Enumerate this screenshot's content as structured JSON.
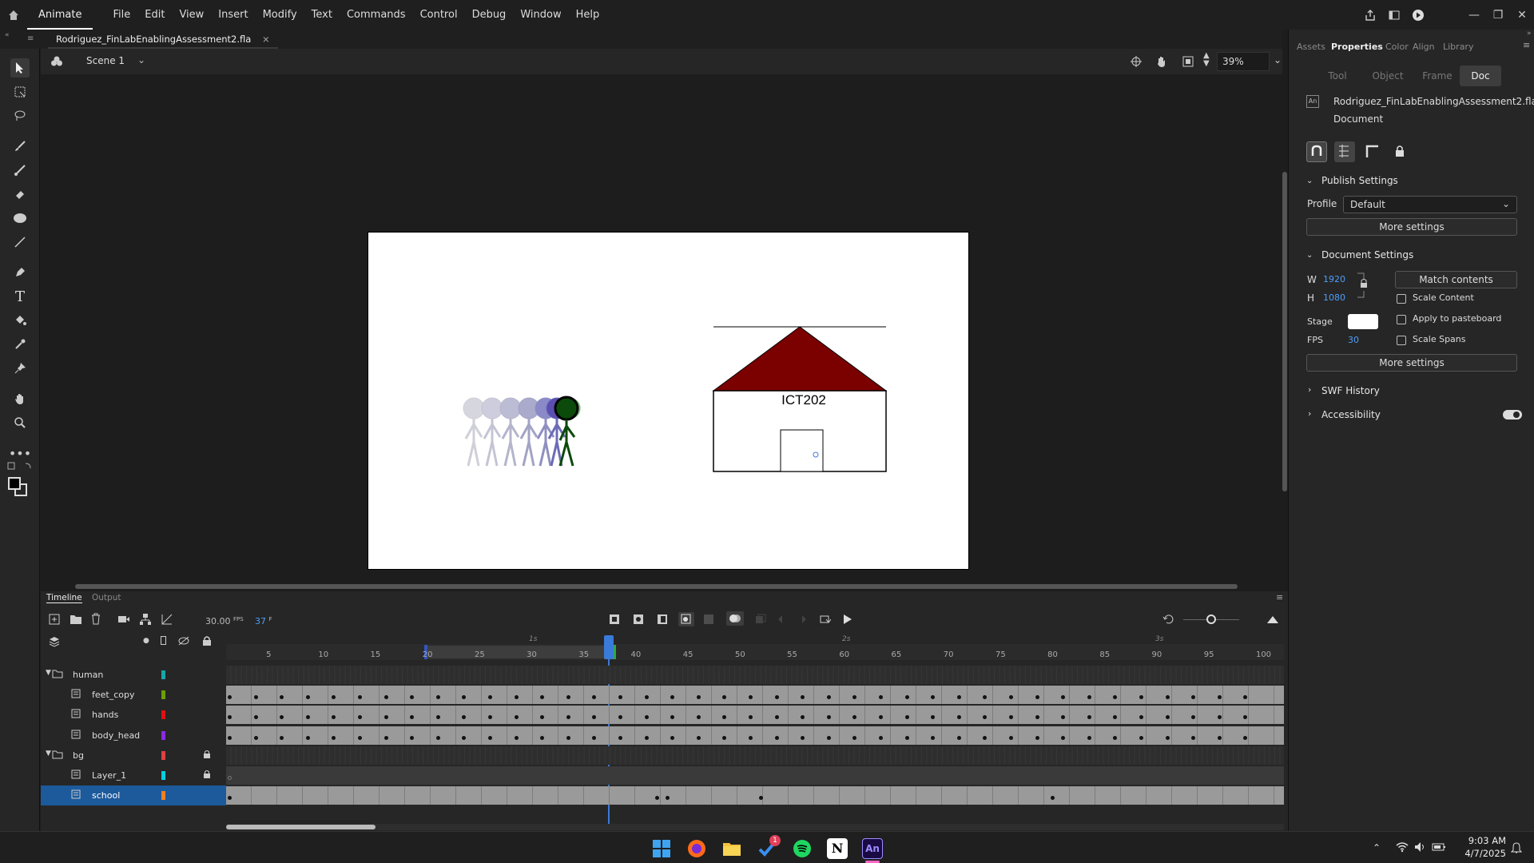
{
  "menubar": {
    "app_name": "Animate",
    "items": [
      "File",
      "Edit",
      "View",
      "Insert",
      "Modify",
      "Text",
      "Commands",
      "Control",
      "Debug",
      "Window",
      "Help"
    ]
  },
  "document_tab": {
    "filename": "Rodriguez_FinLabEnablingAssessment2.fla",
    "close": "×"
  },
  "scene": {
    "name": "Scene 1",
    "zoom": "39%"
  },
  "stage": {
    "house_label": "ICT202",
    "colors": {
      "roof": "#7b0000",
      "stick_figure": "#0b4a0b"
    }
  },
  "right_panel": {
    "tabs": [
      "Assets",
      "Properties",
      "Color",
      "Align",
      "Library"
    ],
    "active_tab": "Properties",
    "subtabs": [
      "Tool",
      "Object",
      "Frame",
      "Doc"
    ],
    "active_subtab": "Doc",
    "doc_filename": "Rodriguez_FinLabEnablingAssessment2.fla",
    "doc_type": "Document",
    "publish": {
      "heading": "Publish Settings",
      "profile_label": "Profile",
      "profile_value": "Default",
      "more_settings": "More settings"
    },
    "document_settings": {
      "heading": "Document Settings",
      "w_label": "W",
      "w_value": "1920",
      "h_label": "H",
      "h_value": "1080",
      "match_contents": "Match contents",
      "scale_content": "Scale Content",
      "stage_label": "Stage",
      "apply_pasteboard": "Apply to pasteboard",
      "fps_label": "FPS",
      "fps_value": "30",
      "scale_spans": "Scale Spans",
      "more_settings": "More settings"
    },
    "swf_history": "SWF History",
    "accessibility": "Accessibility"
  },
  "timeline": {
    "tabs": [
      "Timeline",
      "Output"
    ],
    "fps": "30.00",
    "fps_unit": "FPS",
    "current_frame": "37",
    "frame_unit": "F",
    "ruler_numbers": [
      "5",
      "10",
      "15",
      "20",
      "25",
      "30",
      "35",
      "40",
      "45",
      "50",
      "55",
      "60",
      "65",
      "70",
      "75",
      "80",
      "85",
      "90",
      "95",
      "100"
    ],
    "second_markers": [
      "1s",
      "2s",
      "3s"
    ],
    "layers": [
      {
        "name": "human",
        "type": "folder",
        "color": "#1aa6a6"
      },
      {
        "name": "feet_copy",
        "type": "layer",
        "color": "#6aa000"
      },
      {
        "name": "hands",
        "type": "layer",
        "color": "#e01010"
      },
      {
        "name": "body_head",
        "type": "layer",
        "color": "#8a2be2"
      },
      {
        "name": "bg",
        "type": "folder",
        "color": "#e04040"
      },
      {
        "name": "Layer_1",
        "type": "layer",
        "color": "#00d0e0"
      },
      {
        "name": "school",
        "type": "layer",
        "color": "#f08020"
      }
    ]
  },
  "taskbar": {
    "time": "9:03 AM",
    "date": "4/7/2025",
    "badge": "1"
  }
}
